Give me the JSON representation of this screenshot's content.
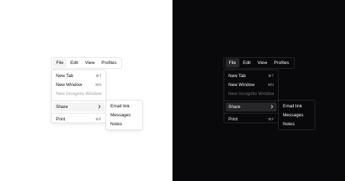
{
  "menubar": {
    "items": [
      {
        "label": "File"
      },
      {
        "label": "Edit"
      },
      {
        "label": "View"
      },
      {
        "label": "Profiles"
      }
    ]
  },
  "file_menu": {
    "new_tab": {
      "label": "New Tab",
      "shortcut": "⌘T"
    },
    "new_window": {
      "label": "New Window",
      "shortcut": "⌘N"
    },
    "new_incognito": {
      "label": "New Incognito Window"
    },
    "share": {
      "label": "Share"
    },
    "print": {
      "label": "Print",
      "shortcut": "⌘P"
    }
  },
  "share_menu": {
    "items": [
      {
        "label": "Email link"
      },
      {
        "label": "Messages"
      },
      {
        "label": "Notes"
      }
    ]
  },
  "colors": {
    "light_background": "#ffffff",
    "dark_background": "#09090b",
    "light_highlight": "#f4f4f5",
    "dark_highlight": "#27272a"
  }
}
